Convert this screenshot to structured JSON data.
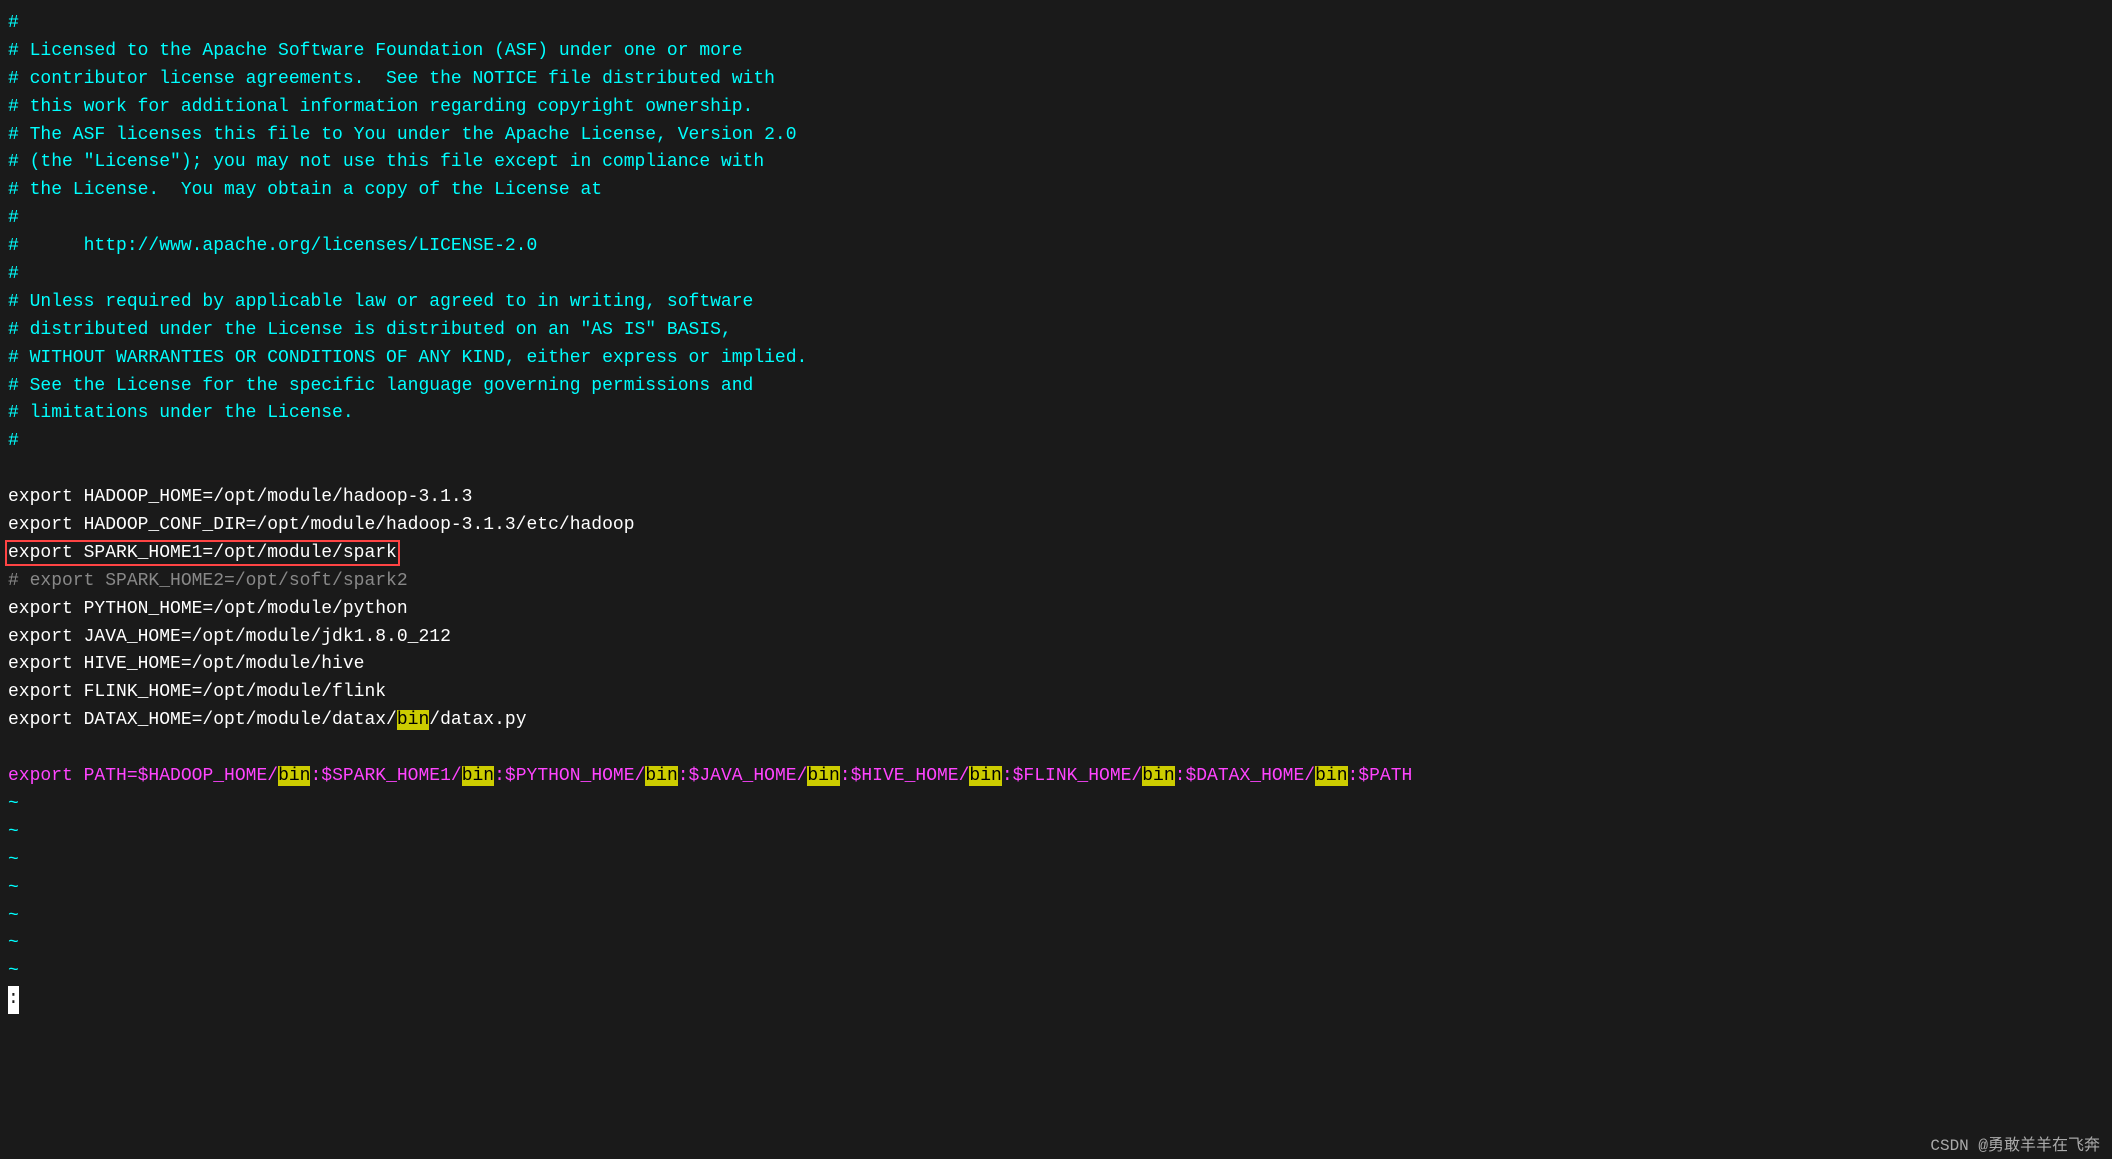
{
  "terminal": {
    "lines": [
      {
        "id": "line1",
        "type": "comment",
        "text": "#"
      },
      {
        "id": "line2",
        "type": "comment",
        "text": "# Licensed to the Apache Software Foundation (ASF) under one or more"
      },
      {
        "id": "line3",
        "type": "comment",
        "text": "# contributor license agreements.  See the NOTICE file distributed with"
      },
      {
        "id": "line4",
        "type": "comment",
        "text": "# this work for additional information regarding copyright ownership."
      },
      {
        "id": "line5",
        "type": "comment",
        "text": "# The ASF licenses this file to You under the Apache License, Version 2.0"
      },
      {
        "id": "line6",
        "type": "comment",
        "text": "# (the \"License\"); you may not use this file except in compliance with"
      },
      {
        "id": "line7",
        "type": "comment",
        "text": "# the License.  You may obtain a copy of the License at"
      },
      {
        "id": "line8",
        "type": "comment",
        "text": "#"
      },
      {
        "id": "line9",
        "type": "comment",
        "text": "#      http://www.apache.org/licenses/LICENSE-2.0"
      },
      {
        "id": "line10",
        "type": "comment",
        "text": "#"
      },
      {
        "id": "line11",
        "type": "comment",
        "text": "# Unless required by applicable law or agreed to in writing, software"
      },
      {
        "id": "line12",
        "type": "comment",
        "text": "# distributed under the License is distributed on an \"AS IS\" BASIS,"
      },
      {
        "id": "line13",
        "type": "comment",
        "text": "# WITHOUT WARRANTIES OR CONDITIONS OF ANY KIND, either express or implied."
      },
      {
        "id": "line14",
        "type": "comment",
        "text": "# See the License for the specific language governing permissions and"
      },
      {
        "id": "line15",
        "type": "comment",
        "text": "# limitations under the License."
      },
      {
        "id": "line16",
        "type": "comment",
        "text": "#"
      },
      {
        "id": "line17",
        "type": "blank",
        "text": ""
      },
      {
        "id": "line18",
        "type": "export",
        "text": "export HADOOP_HOME=/opt/module/hadoop-3.1.3"
      },
      {
        "id": "line19",
        "type": "export",
        "text": "export HADOOP_CONF_DIR=/opt/module/hadoop-3.1.3/etc/hadoop"
      },
      {
        "id": "line20",
        "type": "export-redbox",
        "text": "export SPARK_HOME1=/opt/module/spark"
      },
      {
        "id": "line21",
        "type": "commented-export",
        "text": "# export SPARK_HOME2=/opt/soft/spark2"
      },
      {
        "id": "line22",
        "type": "export",
        "text": "export PYTHON_HOME=/opt/module/python"
      },
      {
        "id": "line23",
        "type": "export",
        "text": "export JAVA_HOME=/opt/module/jdk1.8.0_212"
      },
      {
        "id": "line24",
        "type": "export",
        "text": "export HIVE_HOME=/opt/module/hive"
      },
      {
        "id": "line25",
        "type": "export",
        "text": "export FLINK_HOME=/opt/module/flink"
      },
      {
        "id": "line26",
        "type": "export-bin",
        "text": "export DATAX_HOME=/opt/module/datax/bin/datax.py",
        "highlight_word": "bin",
        "highlight_start": 37,
        "highlight_end": 40
      },
      {
        "id": "line27",
        "type": "blank",
        "text": ""
      },
      {
        "id": "line28",
        "type": "path",
        "text": "export PATH=$HADOOP_HOME/bin:$SPARK_HOME1/bin:$PYTHON_HOME/bin:$JAVA_HOME/bin:$HIVE_HOME/bin:$FLINK_HOME/bin:$DATAX_HOME/bin:$PATH"
      },
      {
        "id": "line29",
        "type": "tilde",
        "text": "~"
      },
      {
        "id": "line30",
        "type": "tilde",
        "text": "~"
      },
      {
        "id": "line31",
        "type": "tilde",
        "text": "~"
      },
      {
        "id": "line32",
        "type": "tilde",
        "text": "~"
      },
      {
        "id": "line33",
        "type": "tilde",
        "text": "~"
      },
      {
        "id": "line34",
        "type": "tilde",
        "text": "~"
      },
      {
        "id": "line35",
        "type": "tilde",
        "text": "~"
      },
      {
        "id": "line36",
        "type": "cursor",
        "text": ":"
      }
    ]
  },
  "bottom_bar": {
    "text": "CSDN @勇敢羊羊在飞奔"
  }
}
